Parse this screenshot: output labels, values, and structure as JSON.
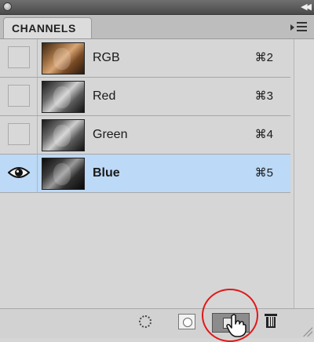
{
  "panel": {
    "tab_label": "CHANNELS"
  },
  "channels": [
    {
      "name": "RGB",
      "shortcut": "⌘2",
      "visible": false,
      "selected": false
    },
    {
      "name": "Red",
      "shortcut": "⌘3",
      "visible": false,
      "selected": false
    },
    {
      "name": "Green",
      "shortcut": "⌘4",
      "visible": false,
      "selected": false
    },
    {
      "name": "Blue",
      "shortcut": "⌘5",
      "visible": true,
      "selected": true
    }
  ],
  "icons": {
    "close": "close-icon",
    "collapse": "double-chevron-right-icon",
    "panel_menu": "panel-menu-icon",
    "eye": "eye-icon",
    "load_selection": "dotted-circle-icon",
    "save_selection": "mask-icon",
    "new_channel": "new-channel-icon",
    "delete": "trash-icon",
    "cursor": "hand-pointer-icon"
  },
  "colors": {
    "selected_row": "#bcd9f7",
    "highlight_ring": "#e01818"
  }
}
